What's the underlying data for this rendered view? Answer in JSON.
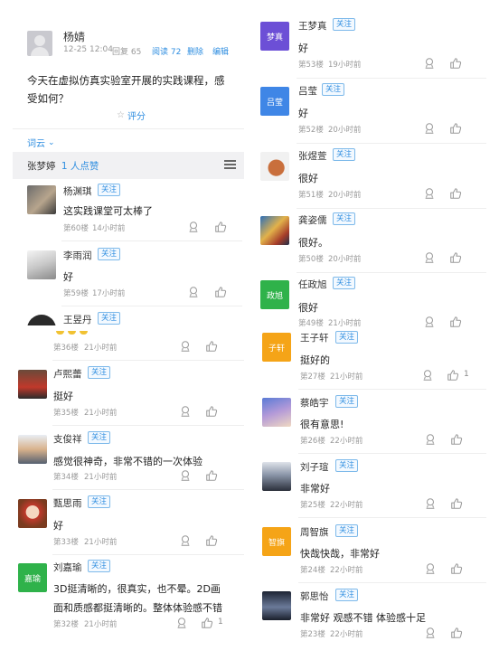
{
  "post": {
    "author": "杨婧",
    "date": "12-25 12:04",
    "likes_label": "回复 65",
    "reads_label": "阅读 72",
    "delete_label": "删除",
    "edit_label": "编辑",
    "question": "今天在虚拟仿真实验室开展的实践课程，感受如何？",
    "rate_label": "评分",
    "wordcloud_label": "词云",
    "liked_by_name": "张梦婷",
    "liked_by_count": "1 人点赞"
  },
  "follow_label": "关注",
  "left_top": [
    {
      "name": "杨渊琪",
      "text": "这实践课堂可太棒了",
      "floor": "第60楼",
      "time": "14小时前"
    },
    {
      "name": "李雨润",
      "text": "好",
      "floor": "第59楼",
      "time": "17小时前"
    },
    {
      "name": "王昱丹"
    }
  ],
  "left_bottom": [
    {
      "floor": "第36楼",
      "time": "21小时前"
    },
    {
      "name": "卢熙蕾",
      "text": "挺好",
      "floor": "第35楼",
      "time": "21小时前"
    },
    {
      "name": "支俊祥",
      "text": "感觉很神奇，非常不错的一次体验",
      "floor": "第34楼",
      "time": "21小时前"
    },
    {
      "name": "甄思雨",
      "text": "好",
      "floor": "第33楼",
      "time": "21小时前"
    },
    {
      "name": "刘嘉瑜",
      "avatar_text": "嘉瑜",
      "text1": "3D挺清晰的，很真实，也不晕。2D画",
      "text2": "面和质感都挺清晰的。整体体验感不错",
      "floor": "第32楼",
      "time": "21小时前",
      "like_count": "1"
    }
  ],
  "right_top": [
    {
      "name": "王梦真",
      "avatar_text": "梦真",
      "text": "好",
      "floor": "第53楼",
      "time": "19小时前"
    },
    {
      "name": "吕莹",
      "avatar_text": "吕莹",
      "text": "好",
      "floor": "第52楼",
      "time": "20小时前"
    },
    {
      "name": "张煜萱",
      "text": "很好",
      "floor": "第51楼",
      "time": "20小时前"
    },
    {
      "name": "龚姿儒",
      "text": "很好。",
      "floor": "第50楼",
      "time": "20小时前"
    },
    {
      "name": "任政旭",
      "avatar_text": "政旭",
      "text": "很好",
      "floor": "第49楼",
      "time": "21小时前"
    }
  ],
  "right_bottom": [
    {
      "name": "王子轩",
      "avatar_text": "子轩",
      "text": "挺好的",
      "floor": "第27楼",
      "time": "21小时前",
      "like_count": "1"
    },
    {
      "name": "蔡皓宇",
      "text": "很有意思!",
      "floor": "第26楼",
      "time": "22小时前"
    },
    {
      "name": "刘子瑄",
      "text": "非常好",
      "floor": "第25楼",
      "time": "22小时前"
    },
    {
      "name": "周智旗",
      "avatar_text": "智旗",
      "text": "快哉快哉，非常好",
      "floor": "第24楼",
      "time": "22小时前"
    },
    {
      "name": "郭思怡",
      "text": "非常好 观感不错 体验感十足",
      "floor": "第23楼",
      "time": "22小时前"
    }
  ],
  "colors": {
    "accent": "#2f8ee0",
    "purple": "#6c4fd6",
    "blue": "#3f86e6",
    "green": "#2fb24a",
    "orange": "#f5a417"
  }
}
